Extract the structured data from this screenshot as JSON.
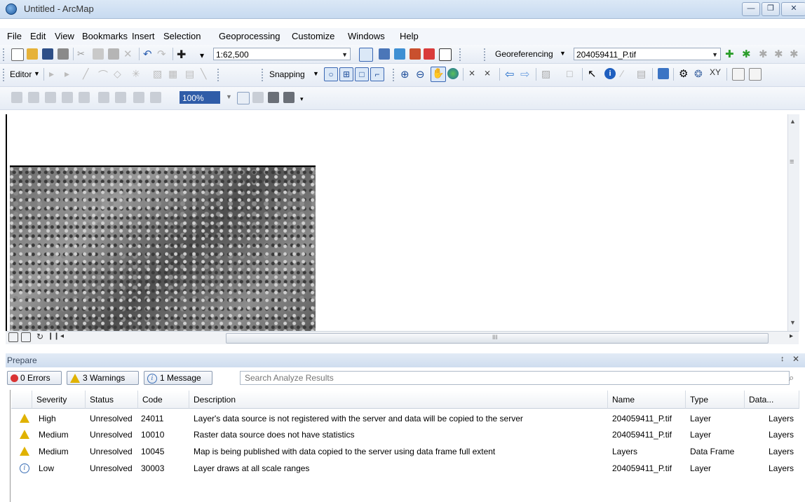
{
  "window": {
    "title": "Untitled - ArcMap"
  },
  "menu": [
    "File",
    "Edit",
    "View",
    "Bookmarks",
    "Insert",
    "Selection",
    "Geoprocessing",
    "Customize",
    "Windows",
    "Help"
  ],
  "standard_toolbar": {
    "scale_value": "1:62,500"
  },
  "georef_toolbar": {
    "label": "Georeferencing",
    "layer_value": "204059411_P.tif"
  },
  "editor_toolbar": {
    "editor_label": "Editor",
    "snapping_label": "Snapping"
  },
  "image_toolbar": {
    "zoom_value": "100%"
  },
  "map": {
    "hscroll_marker": "III"
  },
  "prepare": {
    "title": "Prepare",
    "errors_label": "0 Errors",
    "warnings_label": "3 Warnings",
    "messages_label": "1 Message",
    "search_placeholder": "Search Analyze Results",
    "columns": [
      "Severity",
      "Status",
      "Code",
      "Description",
      "Name",
      "Type",
      "Data..."
    ],
    "rows": [
      {
        "icon": "warning-icon",
        "severity": "High",
        "status": "Unresolved",
        "code": "24011",
        "description": "Layer's data source is not registered with the server and data will be copied to the server",
        "name": "204059411_P.tif",
        "type": "Layer",
        "data": "Layers"
      },
      {
        "icon": "warning-icon",
        "severity": "Medium",
        "status": "Unresolved",
        "code": "10010",
        "description": "Raster data source does not have statistics",
        "name": "204059411_P.tif",
        "type": "Layer",
        "data": "Layers"
      },
      {
        "icon": "warning-icon",
        "severity": "Medium",
        "status": "Unresolved",
        "code": "10045",
        "description": "Map is being published with data copied to the server using data frame full extent",
        "name": "Layers",
        "type": "Data Frame",
        "data": "Layers"
      },
      {
        "icon": "info-icon",
        "severity": "Low",
        "status": "Unresolved",
        "code": "30003",
        "description": "Layer draws at all scale ranges",
        "name": "204059411_P.tif",
        "type": "Layer",
        "data": "Layers"
      }
    ]
  }
}
